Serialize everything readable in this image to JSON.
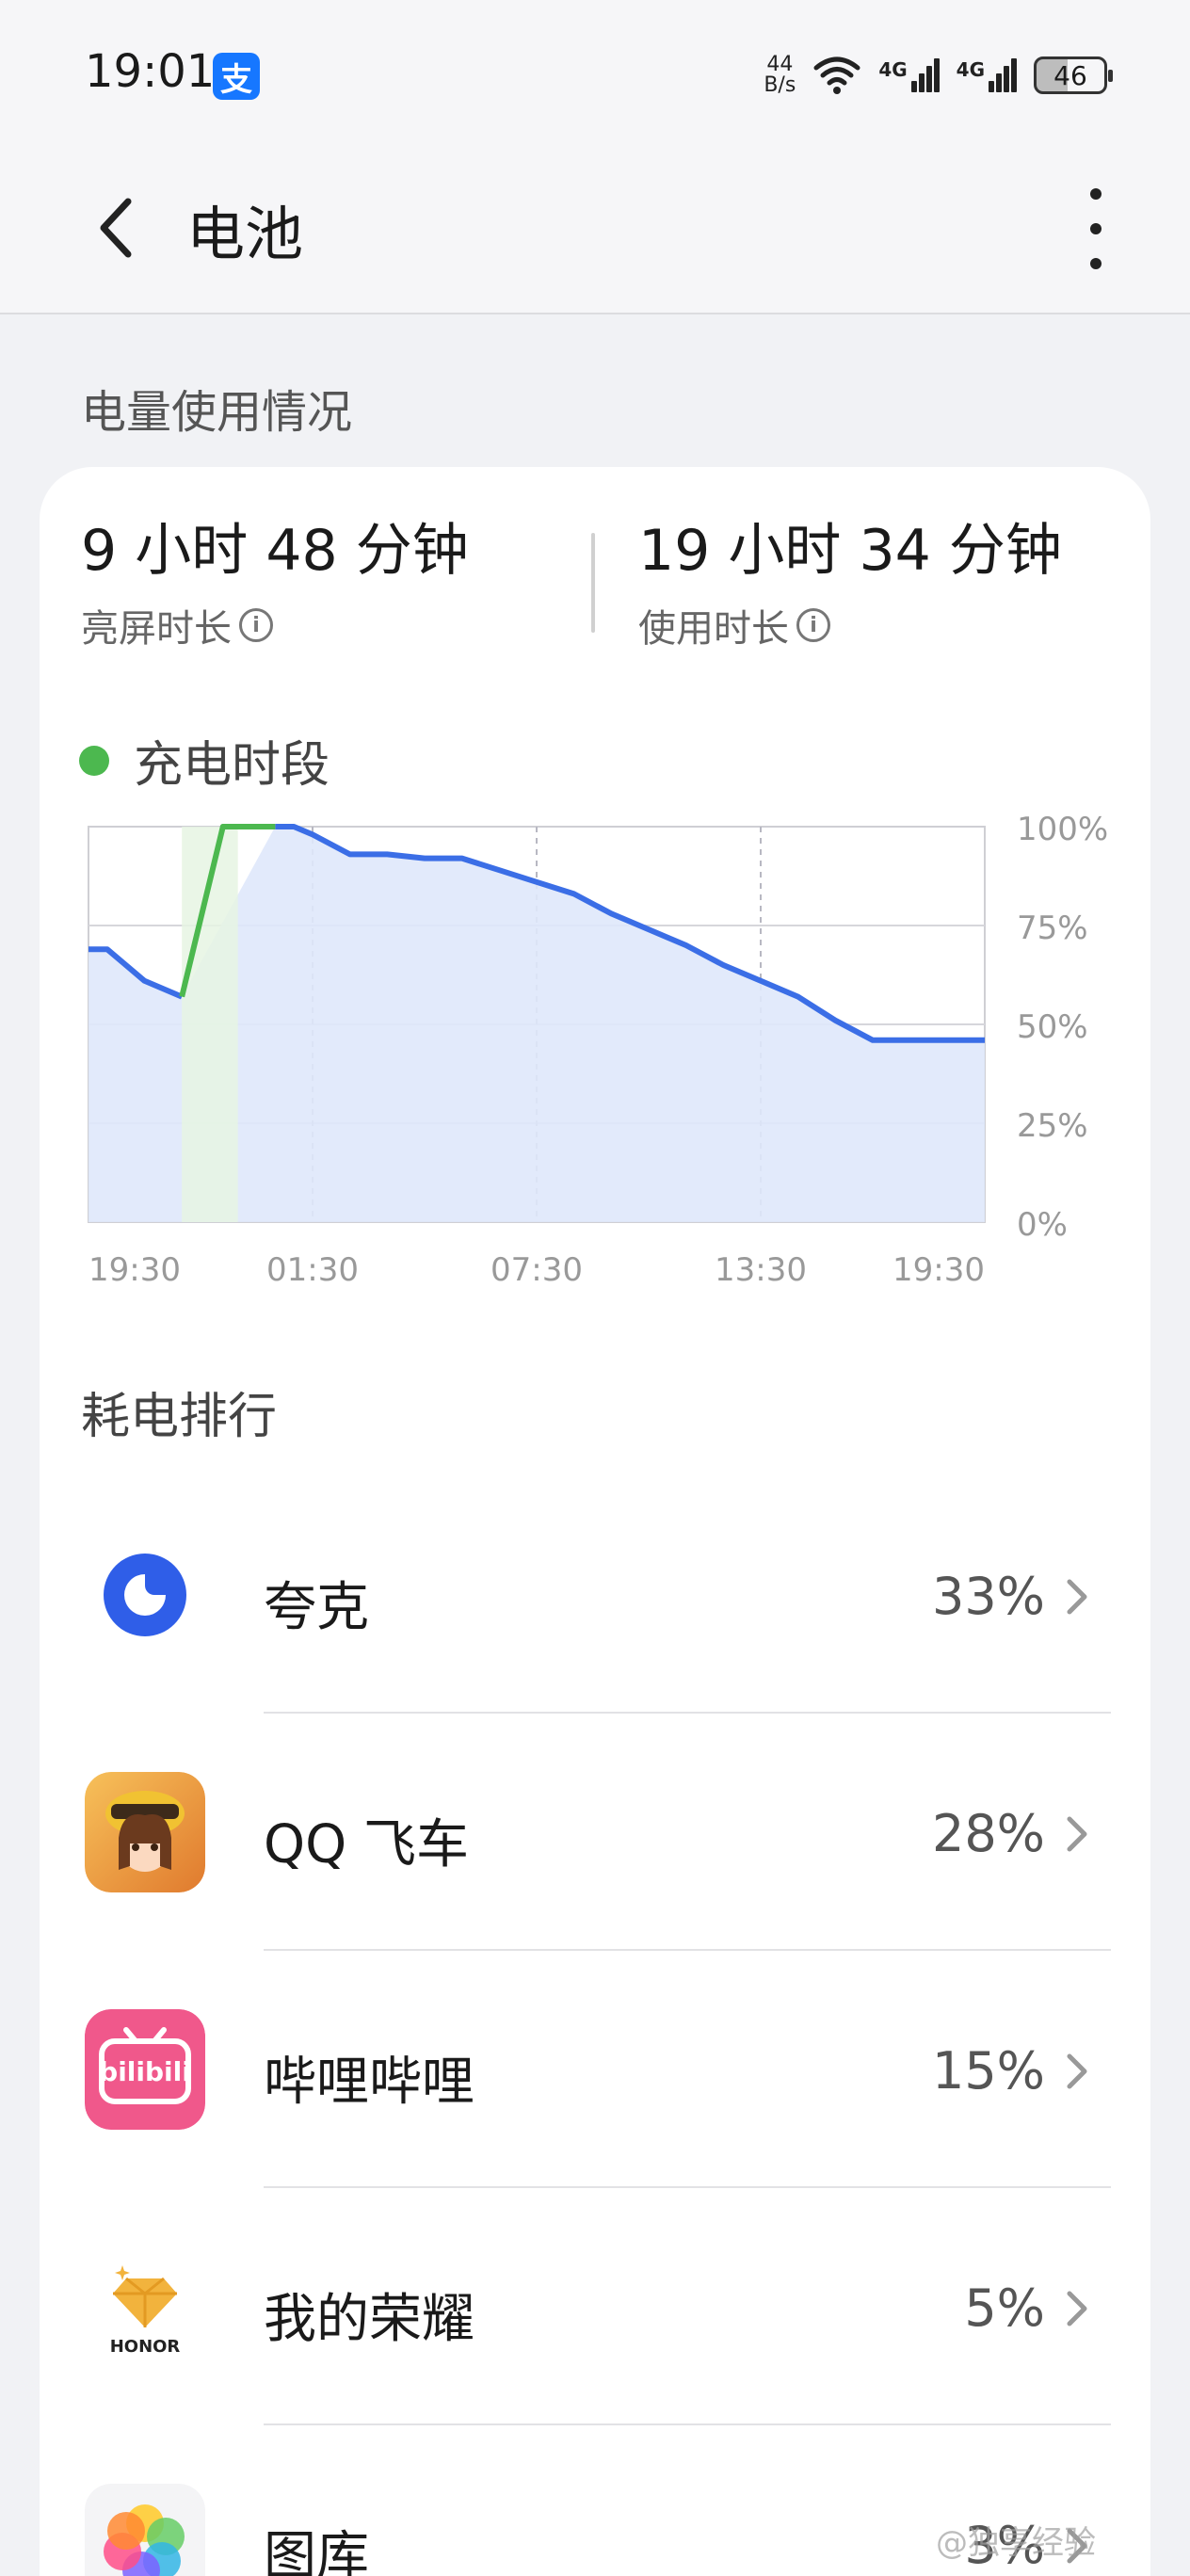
{
  "status_bar": {
    "time": "19:01",
    "alipay_glyph": "支",
    "net_speed_value": "44",
    "net_speed_unit": "B/s",
    "signal1_label": "4G",
    "signal2_label": "4G",
    "battery_level": "46"
  },
  "header": {
    "title": "电池"
  },
  "usage": {
    "section_title": "电量使用情况",
    "screen_on_value": "9 小时 48 分钟",
    "screen_on_label": "亮屏时长",
    "usage_value": "19 小时 34 分钟",
    "usage_label": "使用时长",
    "legend_label": "充电时段"
  },
  "chart_data": {
    "type": "area",
    "title": "",
    "xlabel": "",
    "ylabel": "",
    "x_ticks": [
      "19:30",
      "01:30",
      "07:30",
      "13:30",
      "19:30"
    ],
    "y_ticks": [
      "100%",
      "75%",
      "50%",
      "25%",
      "0%"
    ],
    "ylim": [
      0,
      100
    ],
    "x_unit": "hours since 19:30",
    "series": [
      {
        "role": "discharge",
        "points": [
          [
            0,
            69
          ],
          [
            0.5,
            69
          ],
          [
            1.5,
            61
          ],
          [
            2.5,
            57
          ],
          [
            5,
            100
          ],
          [
            5.5,
            100
          ],
          [
            6,
            98
          ],
          [
            7,
            93
          ],
          [
            8,
            93
          ],
          [
            9,
            92
          ],
          [
            10,
            92
          ],
          [
            11,
            89
          ],
          [
            12,
            86
          ],
          [
            13,
            83
          ],
          [
            14,
            78
          ],
          [
            14.5,
            76
          ],
          [
            15.5,
            72
          ],
          [
            16,
            70
          ],
          [
            17,
            65
          ],
          [
            18,
            61
          ],
          [
            19,
            57
          ],
          [
            20,
            51
          ],
          [
            21,
            46
          ],
          [
            24,
            46
          ],
          [
            23.0,
            46
          ]
        ]
      }
    ],
    "charging_period": [
      2.5,
      4.0
    ],
    "colors": {
      "line": "#3b6ee6",
      "fill": "#dfe8fb",
      "charging_line": "#4cb84f",
      "charging_fill": "#e6f5e3"
    },
    "grid": true
  },
  "ranking": {
    "title": "耗电排行",
    "apps": [
      {
        "name": "夸克",
        "percent": "33%",
        "icon": "quark-icon"
      },
      {
        "name": "QQ 飞车",
        "percent": "28%",
        "icon": "qq-speed-icon"
      },
      {
        "name": "哔哩哔哩",
        "percent": "15%",
        "icon": "bilibili-icon",
        "icon_text": "bilibili"
      },
      {
        "name": "我的荣耀",
        "percent": "5%",
        "icon": "honor-icon",
        "icon_text": "HONOR"
      },
      {
        "name": "图库",
        "percent": "3%",
        "icon": "gallery-icon"
      }
    ]
  },
  "watermark": "@独享经验"
}
